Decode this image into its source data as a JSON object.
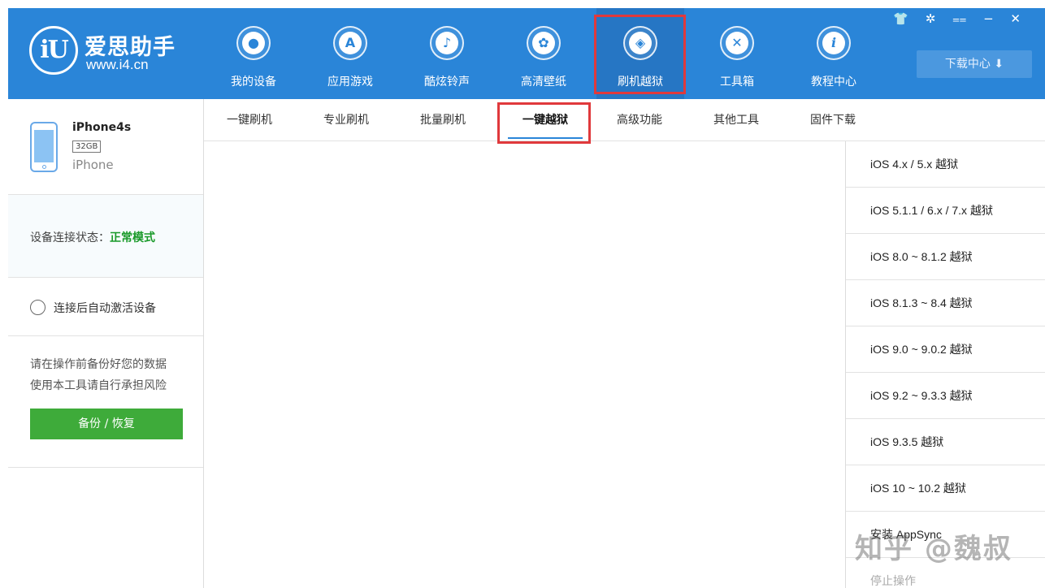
{
  "app": {
    "logo_mark": "iU",
    "name": "爱思助手",
    "url": "www.i4.cn"
  },
  "nav": [
    {
      "label": "我的设备",
      "icon": "apple-icon",
      "glyph": ""
    },
    {
      "label": "应用游戏",
      "icon": "app-store-icon",
      "glyph": "A"
    },
    {
      "label": "酷炫铃声",
      "icon": "bell-icon",
      "glyph": "♪"
    },
    {
      "label": "高清壁纸",
      "icon": "flower-icon",
      "glyph": "✿"
    },
    {
      "label": "刷机越狱",
      "icon": "dropbox-icon",
      "glyph": "◈"
    },
    {
      "label": "工具箱",
      "icon": "tools-icon",
      "glyph": "✕"
    },
    {
      "label": "教程中心",
      "icon": "info-icon",
      "glyph": "i"
    }
  ],
  "window_controls": "👕 ✲ ⩵ − ✕",
  "download_center": "下载中心 ⬇",
  "device": {
    "name": "iPhone4s",
    "capacity": "32GB",
    "type": "iPhone"
  },
  "connection": {
    "label": "设备连接状态：",
    "value": "正常模式"
  },
  "auto_activate": "连接后自动激活设备",
  "warning": {
    "line1": "请在操作前备份好您的数据",
    "line2": "使用本工具请自行承担风险"
  },
  "backup_button": "备份 / 恢复",
  "tabs": [
    "一键刷机",
    "专业刷机",
    "批量刷机",
    "一键越狱",
    "高级功能",
    "其他工具",
    "固件下载"
  ],
  "jailbreak_options": [
    "iOS 4.x / 5.x 越狱",
    "iOS 5.1.1 / 6.x / 7.x 越狱",
    "iOS 8.0 ~ 8.1.2 越狱",
    "iOS 8.1.3 ~ 8.4 越狱",
    "iOS 9.0 ~ 9.0.2 越狱",
    "iOS 9.2 ~ 9.3.3 越狱",
    "iOS 9.3.5 越狱",
    "iOS 10 ~ 10.2 越狱",
    "安装 AppSync",
    "停止操作"
  ],
  "watermark": "知乎 @魏叔",
  "colors": {
    "header": "#2a85d8",
    "highlight": "#e0393c",
    "status_ok": "#1a9a2a",
    "backup_button": "#3eab3a"
  }
}
